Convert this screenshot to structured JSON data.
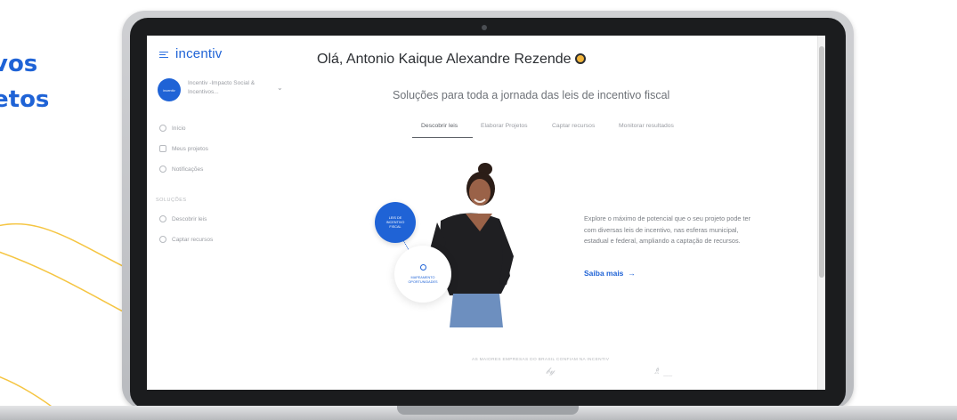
{
  "marketing": {
    "line1": "vos",
    "line2": "etos"
  },
  "app": {
    "logo": "incentiv",
    "org_avatar": "incentiv",
    "org_name": "Incentiv -Impacto Social & Incentivos..."
  },
  "sidebar": {
    "items": [
      {
        "label": "Início",
        "icon": "home-icon"
      },
      {
        "label": "Meus projetos",
        "icon": "folder-icon"
      },
      {
        "label": "Notificações",
        "icon": "bell-icon"
      }
    ],
    "section_label": "SOLUÇÕES",
    "solutions": [
      {
        "label": "Descobrir leis",
        "icon": "discover-icon"
      },
      {
        "label": "Captar recursos",
        "icon": "fundraise-icon"
      }
    ]
  },
  "main": {
    "greeting": "Olá, Antonio Kaique Alexandre Rezende",
    "subtitle": "Soluções para toda a jornada das leis de incentivo fiscal",
    "tabs": [
      "Descobrir leis",
      "Elaborar Projetos",
      "Captar recursos",
      "Monitorar resultados"
    ],
    "active_tab": "Descobrir leis",
    "hero_badge": "LEIS DE INCENTIVO FISCAL",
    "hero_bubble": "MAPEAMENTO OPORTUNIDADES",
    "description": "Explore o máximo de potencial que o seu projeto pode ter com diversas leis de incentivo, nas esferas municipal, estadual e federal, ampliando a captação de recursos.",
    "cta": "Saiba mais",
    "cta_arrow": "→",
    "footer_note": "AS MAIORES EMPRESAS DO BRASIL CONFIAM NA INCENTIV"
  },
  "colors": {
    "accent": "#1f63d6",
    "deco_yellow": "#f5c542"
  }
}
